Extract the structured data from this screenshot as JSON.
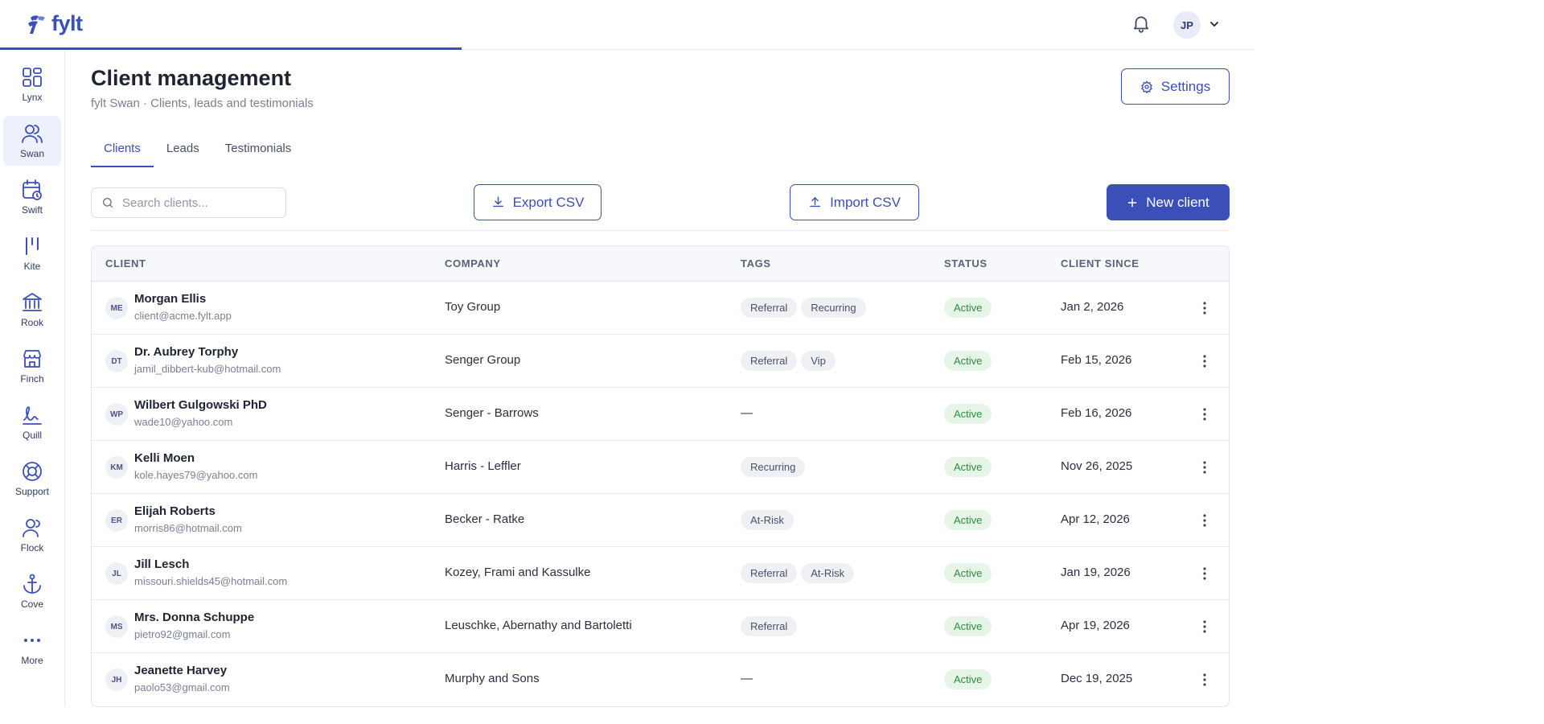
{
  "app": {
    "logo_text": "fylt",
    "brand_color": "#3b4fb8",
    "user_initials": "JP"
  },
  "sidebar": {
    "items": [
      {
        "label": "Lynx",
        "icon": "grid-icon",
        "active": false
      },
      {
        "label": "Swan",
        "icon": "users-icon",
        "active": true
      },
      {
        "label": "Swift",
        "icon": "calendar-clock-icon",
        "active": false
      },
      {
        "label": "Kite",
        "icon": "bars-icon",
        "active": false
      },
      {
        "label": "Rook",
        "icon": "bank-icon",
        "active": false
      },
      {
        "label": "Finch",
        "icon": "store-icon",
        "active": false
      },
      {
        "label": "Quill",
        "icon": "signature-icon",
        "active": false
      },
      {
        "label": "Support",
        "icon": "lifebuoy-icon",
        "active": false
      },
      {
        "label": "Flock",
        "icon": "group-icon",
        "active": false
      },
      {
        "label": "Cove",
        "icon": "anchor-icon",
        "active": false
      },
      {
        "label": "More",
        "icon": "more-horizontal-icon",
        "active": false
      }
    ]
  },
  "header": {
    "title": "Client management",
    "subtitle": "fylt Swan · Clients, leads and testimonials",
    "settings_label": "Settings"
  },
  "tabs": [
    {
      "label": "Clients",
      "active": true
    },
    {
      "label": "Leads",
      "active": false
    },
    {
      "label": "Testimonials",
      "active": false
    }
  ],
  "toolbar": {
    "search_placeholder": "Search clients...",
    "export_label": "Export CSV",
    "import_label": "Import CSV",
    "new_label": "New client"
  },
  "table": {
    "columns": [
      "CLIENT",
      "COMPANY",
      "TAGS",
      "STATUS",
      "CLIENT SINCE"
    ],
    "rows": [
      {
        "initials": "ME",
        "name": "Morgan Ellis",
        "email": "client@acme.fylt.app",
        "company": "Toy Group",
        "tags": [
          "Referral",
          "Recurring"
        ],
        "status": "Active",
        "since": "Jan 2, 2026"
      },
      {
        "initials": "DT",
        "name": "Dr. Aubrey Torphy",
        "email": "jamil_dibbert-kub@hotmail.com",
        "company": "Senger Group",
        "tags": [
          "Referral",
          "Vip"
        ],
        "status": "Active",
        "since": "Feb 15, 2026"
      },
      {
        "initials": "WP",
        "name": "Wilbert Gulgowski PhD",
        "email": "wade10@yahoo.com",
        "company": "Senger - Barrows",
        "tags": [],
        "status": "Active",
        "since": "Feb 16, 2026"
      },
      {
        "initials": "KM",
        "name": "Kelli Moen",
        "email": "kole.hayes79@yahoo.com",
        "company": "Harris - Leffler",
        "tags": [
          "Recurring"
        ],
        "status": "Active",
        "since": "Nov 26, 2025"
      },
      {
        "initials": "ER",
        "name": "Elijah Roberts",
        "email": "morris86@hotmail.com",
        "company": "Becker - Ratke",
        "tags": [
          "At-Risk"
        ],
        "status": "Active",
        "since": "Apr 12, 2026"
      },
      {
        "initials": "JL",
        "name": "Jill Lesch",
        "email": "missouri.shields45@hotmail.com",
        "company": "Kozey, Frami and Kassulke",
        "tags": [
          "Referral",
          "At-Risk"
        ],
        "status": "Active",
        "since": "Jan 19, 2026"
      },
      {
        "initials": "MS",
        "name": "Mrs. Donna Schuppe",
        "email": "pietro92@gmail.com",
        "company": "Leuschke, Abernathy and Bartoletti",
        "tags": [
          "Referral"
        ],
        "status": "Active",
        "since": "Apr 19, 2026"
      },
      {
        "initials": "JH",
        "name": "Jeanette Harvey",
        "email": "paolo53@gmail.com",
        "company": "Murphy and Sons",
        "tags": [],
        "status": "Active",
        "since": "Dec 19, 2025"
      }
    ],
    "empty_tags_text": "—"
  }
}
